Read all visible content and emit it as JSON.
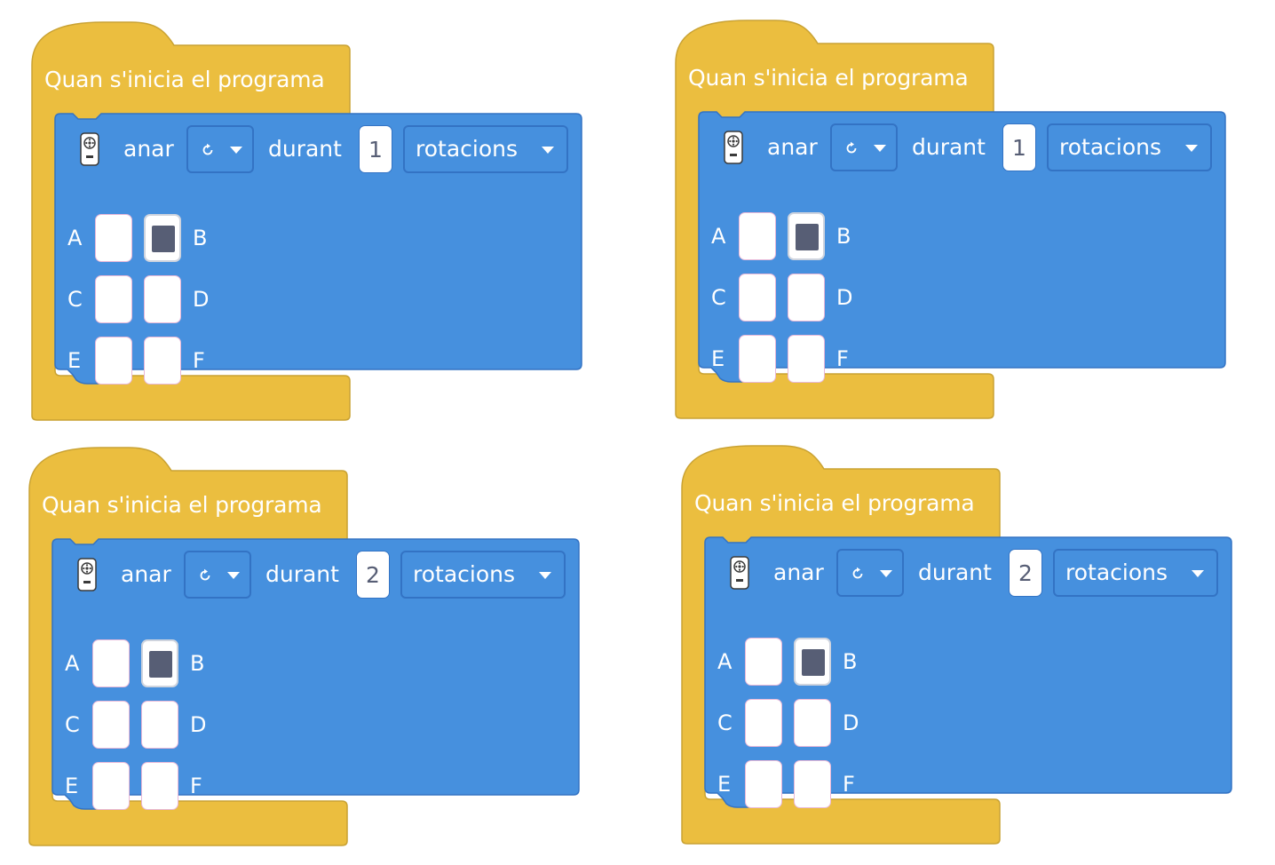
{
  "colors": {
    "event_yellow": "#ebbe3f",
    "event_border": "#c9a233",
    "motion_blue": "#4690de",
    "motion_border": "#3373c4",
    "text_white": "#ffffff",
    "input_text": "#575e75",
    "selected_fill": "#575e75"
  },
  "programs": [
    {
      "hat_title": "Quan s'inicia el programa",
      "block": {
        "icon": "hub-icon",
        "verb": "anar",
        "direction_icon": "rotate-icon",
        "preposition": "durant",
        "amount": "1",
        "unit": "rotacions",
        "ports": [
          {
            "label": "A",
            "selected": false
          },
          {
            "label": "B",
            "selected": true
          },
          {
            "label": "C",
            "selected": false
          },
          {
            "label": "D",
            "selected": false
          },
          {
            "label": "E",
            "selected": false
          },
          {
            "label": "F",
            "selected": false
          }
        ]
      }
    },
    {
      "hat_title": "Quan s'inicia el programa",
      "block": {
        "icon": "hub-icon",
        "verb": "anar",
        "direction_icon": "rotate-icon",
        "preposition": "durant",
        "amount": "1",
        "unit": "rotacions",
        "ports": [
          {
            "label": "A",
            "selected": false
          },
          {
            "label": "B",
            "selected": true
          },
          {
            "label": "C",
            "selected": false
          },
          {
            "label": "D",
            "selected": false
          },
          {
            "label": "E",
            "selected": false
          },
          {
            "label": "F",
            "selected": false
          }
        ]
      }
    },
    {
      "hat_title": "Quan s'inicia el programa",
      "block": {
        "icon": "hub-icon",
        "verb": "anar",
        "direction_icon": "rotate-icon",
        "preposition": "durant",
        "amount": "2",
        "unit": "rotacions",
        "ports": [
          {
            "label": "A",
            "selected": false
          },
          {
            "label": "B",
            "selected": true
          },
          {
            "label": "C",
            "selected": false
          },
          {
            "label": "D",
            "selected": false
          },
          {
            "label": "E",
            "selected": false
          },
          {
            "label": "F",
            "selected": false
          }
        ]
      }
    },
    {
      "hat_title": "Quan s'inicia el programa",
      "block": {
        "icon": "hub-icon",
        "verb": "anar",
        "direction_icon": "rotate-icon",
        "preposition": "durant",
        "amount": "2",
        "unit": "rotacions",
        "ports": [
          {
            "label": "A",
            "selected": false
          },
          {
            "label": "B",
            "selected": true
          },
          {
            "label": "C",
            "selected": false
          },
          {
            "label": "D",
            "selected": false
          },
          {
            "label": "E",
            "selected": false
          },
          {
            "label": "F",
            "selected": false
          }
        ]
      }
    }
  ]
}
